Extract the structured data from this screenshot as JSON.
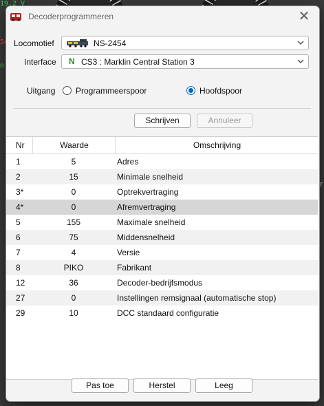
{
  "background": {
    "green_text": "19,2 V",
    "red_text": "50",
    "green_text2": "o",
    "right_text": "r"
  },
  "dialog": {
    "title": "Decoderprogrammeren",
    "close_glyph": "✕"
  },
  "locomotief": {
    "label": "Locomotief",
    "value": "NS-2454"
  },
  "interface": {
    "label": "Interface",
    "badge": "N",
    "value": "CS3 : Marklin Central Station 3"
  },
  "uitgang": {
    "label": "Uitgang",
    "options": [
      {
        "label": "Programmeerspoor",
        "checked": false
      },
      {
        "label": "Hoofdspoor",
        "checked": true
      }
    ]
  },
  "actions": {
    "write_label": "Schrijven",
    "cancel_label": "Annuleer"
  },
  "table": {
    "headers": [
      "Nr",
      "Waarde",
      "Omschrijving"
    ],
    "rows": [
      {
        "nr": "1",
        "waarde": "5",
        "omschrijving": "Adres"
      },
      {
        "nr": "2",
        "waarde": "15",
        "omschrijving": "Minimale snelheid"
      },
      {
        "nr": "3*",
        "waarde": "0",
        "omschrijving": "Optrekvertraging"
      },
      {
        "nr": "4*",
        "waarde": "0",
        "omschrijving": "Afremvertraging"
      },
      {
        "nr": "5",
        "waarde": "155",
        "omschrijving": "Maximale snelheid"
      },
      {
        "nr": "6",
        "waarde": "75",
        "omschrijving": "Middensnelheid"
      },
      {
        "nr": "7",
        "waarde": "4",
        "omschrijving": "Versie"
      },
      {
        "nr": "8",
        "waarde": "PIKO",
        "omschrijving": "Fabrikant"
      },
      {
        "nr": "12",
        "waarde": "36",
        "omschrijving": "Decoder-bedrijfsmodus"
      },
      {
        "nr": "27",
        "waarde": "0",
        "omschrijving": "Instellingen remsignaal (automatische stop)"
      },
      {
        "nr": "29",
        "waarde": "10",
        "omschrijving": "DCC standaard configuratie"
      }
    ],
    "selected_index": 3
  },
  "footer": {
    "apply_label": "Pas toe",
    "reset_label": "Herstel",
    "clear_label": "Leeg"
  },
  "colors": {
    "accent": "#0067c0",
    "interface_badge": "#2e8b2e",
    "selected_row": "#d6d6d6"
  }
}
